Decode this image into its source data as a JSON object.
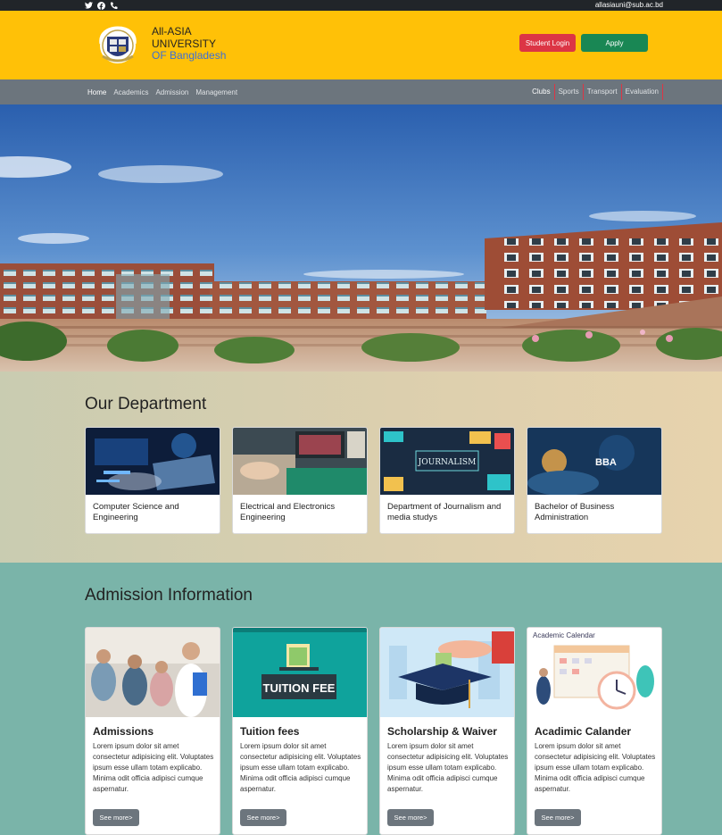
{
  "topbar": {
    "icons": [
      "twitter-icon",
      "facebook-icon",
      "phone-icon"
    ],
    "email": "allasiauni@sub.ac.bd"
  },
  "header": {
    "brand_line1": "All-ASIA",
    "brand_line2": "UNIVERSITY",
    "brand_line3": "OF Bangladesh",
    "student_login": "Student Login",
    "apply": "Apply"
  },
  "nav": {
    "left": [
      "Home",
      "Academics",
      "Admission",
      "Management"
    ],
    "right": [
      "Clubs",
      "Sports",
      "Transport",
      "Evaluation"
    ]
  },
  "departments": {
    "title": "Our Department",
    "cards": [
      {
        "label": "Computer Science and Engineering"
      },
      {
        "label": "Electrical and Electronics Engineering"
      },
      {
        "label": "Department of Journalism and media studys",
        "image_text": "JOURNALISM"
      },
      {
        "label": "Bachelor of Business Administration",
        "image_text": "BBA"
      }
    ]
  },
  "admission": {
    "title": "Admission Information",
    "cards": [
      {
        "title": "Admissions",
        "body": "Lorem ipsum dolor sit amet consectetur adipisicing elit. Voluptates ipsum esse ullam totam explicabo. Minima odit officia adipisci cumque aspernatur.",
        "button": "See more>"
      },
      {
        "title": "Tuition fees",
        "image_text": "TUITION FEE",
        "body": "Lorem ipsum dolor sit amet consectetur adipisicing elit. Voluptates ipsum esse ullam totam explicabo. Minima odit officia adipisci cumque aspernatur.",
        "button": "See more>"
      },
      {
        "title": "Scholarship & Waiver",
        "body": "Lorem ipsum dolor sit amet consectetur adipisicing elit. Voluptates ipsum esse ullam totam explicabo. Minima odit officia adipisci cumque aspernatur.",
        "button": "See more>"
      },
      {
        "title": "Acadimic Calander",
        "image_text": "Academic Calendar",
        "body": "Lorem ipsum dolor sit amet consectetur adipisicing elit. Voluptates ipsum esse ullam totam explicabo. Minima odit officia adipisci cumque aspernatur.",
        "button": "See more>"
      }
    ]
  },
  "colors": {
    "topbar": "#212529",
    "header": "#ffc107",
    "nav": "#6c757d",
    "login_button": "#dc3545",
    "apply_button": "#198754",
    "admission_bg": "#7ab4a9"
  }
}
